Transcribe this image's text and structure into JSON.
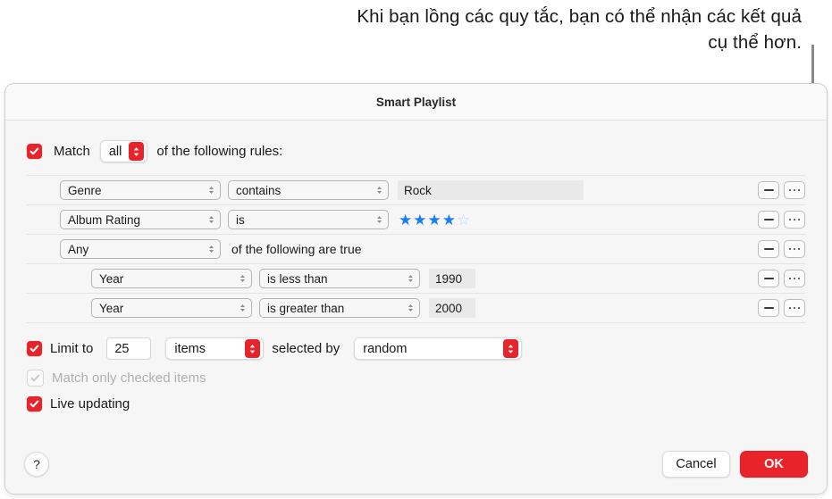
{
  "callout": {
    "text": "Khi bạn lồng các quy tắc, bạn có thể nhận các kết quả cụ thể hơn."
  },
  "dialog": {
    "title": "Smart Playlist",
    "match": {
      "checkbox_checked": true,
      "label": "Match",
      "selector_value": "all",
      "tail_label": "of the following rules:"
    },
    "rules": [
      {
        "indent": 1,
        "field": "Genre",
        "operator": "contains",
        "value_type": "text",
        "value": "Rock",
        "remove_label": "−",
        "more_label": "•••"
      },
      {
        "indent": 1,
        "field": "Album Rating",
        "operator": "is",
        "value_type": "stars",
        "stars_filled": 4,
        "stars_total": 5,
        "remove_label": "−",
        "more_label": "•••"
      },
      {
        "indent": 1,
        "field": "Any",
        "value_type": "group",
        "group_tail": "of the following are true",
        "remove_label": "−",
        "more_label": "•••"
      },
      {
        "indent": 2,
        "field": "Year",
        "operator": "is less than",
        "value_type": "year",
        "value": "1990",
        "remove_label": "−",
        "more_label": "•••"
      },
      {
        "indent": 2,
        "field": "Year",
        "operator": "is greater than",
        "value_type": "year",
        "value": "2000",
        "remove_label": "−",
        "more_label": "•••"
      }
    ],
    "options": {
      "limit_checked": true,
      "limit_label": "Limit to",
      "limit_count": "25",
      "limit_unit": "items",
      "selected_by_label": "selected by",
      "selected_by_value": "random",
      "match_checked_label": "Match only checked items",
      "match_checked_enabled": false,
      "live_updating_label": "Live updating",
      "live_updating_checked": true
    },
    "footer": {
      "help_label": "?",
      "cancel_label": "Cancel",
      "ok_label": "OK"
    }
  },
  "colors": {
    "accent_red": "#e8232a",
    "star_blue": "#1a7ef0",
    "star_empty": "#bdd9f7",
    "callout_gray": "#8a8a8a"
  }
}
